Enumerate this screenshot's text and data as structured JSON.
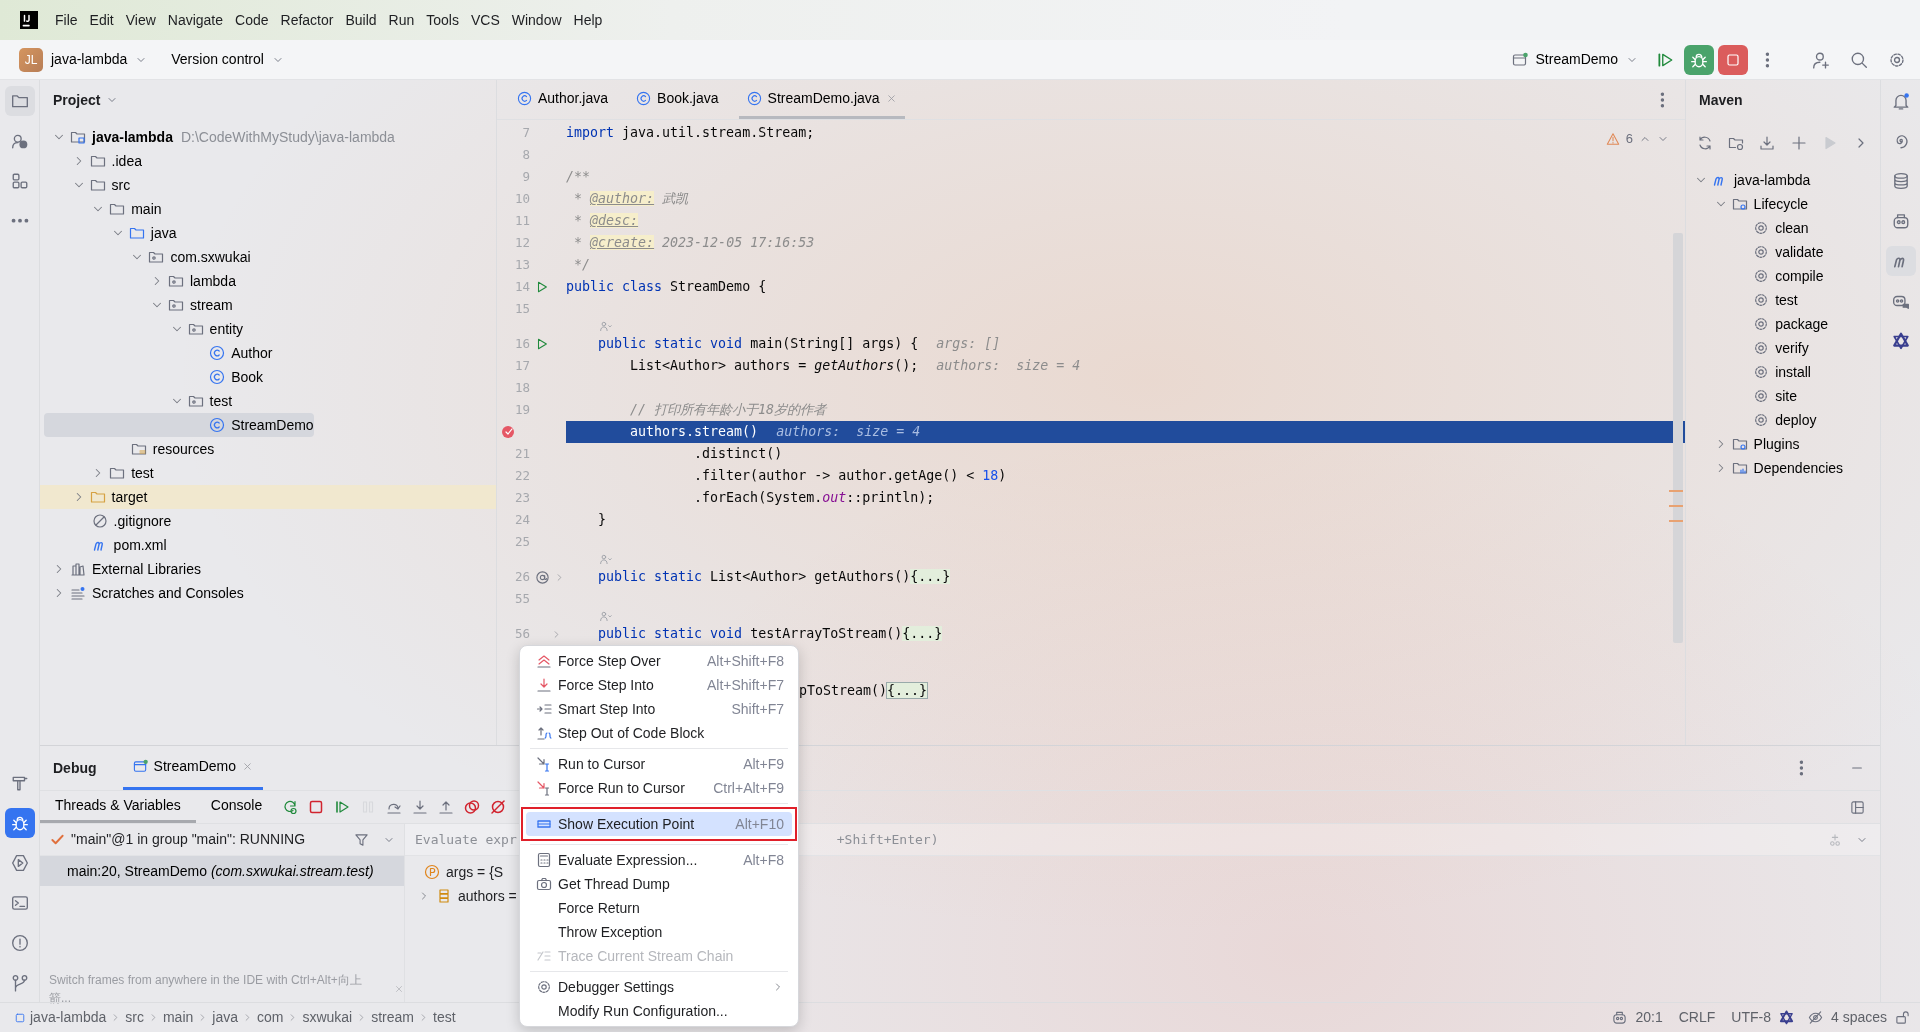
{
  "menu_bar": {
    "items": [
      "File",
      "Edit",
      "View",
      "Navigate",
      "Code",
      "Refactor",
      "Build",
      "Run",
      "Tools",
      "VCS",
      "Window",
      "Help"
    ]
  },
  "toolbar": {
    "project_initials": "JL",
    "project": "java-lambda",
    "vcs": "Version control",
    "run_config": "StreamDemo"
  },
  "project_panel": {
    "title": "Project",
    "tree": [
      {
        "label": "java-lambda",
        "path": "D:\\CodeWithMyStudy\\java-lambda",
        "kind": "module",
        "expanded": true,
        "selected": false,
        "children": [
          {
            "label": ".idea",
            "kind": "folder",
            "expanded": false,
            "selected": false
          },
          {
            "label": "src",
            "kind": "folder",
            "expanded": true,
            "selected": false,
            "children": [
              {
                "label": "main",
                "kind": "folder",
                "expanded": true,
                "selected": false,
                "children": [
                  {
                    "label": "java",
                    "kind": "source-folder",
                    "expanded": true,
                    "selected": false,
                    "children": [
                      {
                        "label": "com.sxwukai",
                        "kind": "package",
                        "expanded": true,
                        "selected": false,
                        "children": [
                          {
                            "label": "lambda",
                            "kind": "package",
                            "expanded": false,
                            "selected": false
                          },
                          {
                            "label": "stream",
                            "kind": "package",
                            "expanded": true,
                            "selected": false,
                            "children": [
                              {
                                "label": "entity",
                                "kind": "package",
                                "expanded": true,
                                "selected": false,
                                "children": [
                                  {
                                    "label": "Author",
                                    "kind": "class",
                                    "selected": false
                                  },
                                  {
                                    "label": "Book",
                                    "kind": "class",
                                    "selected": false
                                  }
                                ]
                              },
                              {
                                "label": "test",
                                "kind": "package",
                                "expanded": true,
                                "selected": false,
                                "children": [
                                  {
                                    "label": "StreamDemo",
                                    "kind": "class",
                                    "selected": true
                                  }
                                ]
                              }
                            ]
                          }
                        ]
                      }
                    ]
                  },
                  {
                    "label": "resources",
                    "kind": "resources-folder",
                    "selected": false
                  }
                ]
              },
              {
                "label": "test",
                "kind": "folder",
                "expanded": false,
                "selected": false
              }
            ]
          },
          {
            "label": "target",
            "kind": "excluded-folder",
            "expanded": false,
            "selected": false
          },
          {
            "label": ".gitignore",
            "kind": "ignore-file",
            "selected": false
          },
          {
            "label": "pom.xml",
            "kind": "maven-file",
            "selected": false
          }
        ]
      },
      {
        "label": "External Libraries",
        "kind": "libraries",
        "expanded": false,
        "selected": false
      },
      {
        "label": "Scratches and Consoles",
        "kind": "scratches",
        "expanded": false,
        "selected": false
      }
    ]
  },
  "editor": {
    "tabs": [
      {
        "label": "Author.java",
        "selected": false
      },
      {
        "label": "Book.java",
        "selected": false
      },
      {
        "label": "StreamDemo.java",
        "selected": true
      }
    ],
    "problems": "6",
    "lines": [
      {
        "kind": "code",
        "number": "7",
        "current": false,
        "tokens": [
          {
            "kind": "keyword",
            "text": "import "
          },
          {
            "kind": "plain",
            "text": "java.util.stream.Stream;"
          }
        ]
      },
      {
        "kind": "code",
        "number": "8",
        "current": false
      },
      {
        "kind": "code",
        "number": "9",
        "current": false,
        "tokens": [
          {
            "kind": "comment",
            "text": "/**"
          }
        ]
      },
      {
        "kind": "code",
        "number": "10",
        "current": false,
        "tokens": [
          {
            "kind": "comment",
            "text": " * "
          },
          {
            "kind": "doc-tag",
            "text": "@author:"
          },
          {
            "kind": "comment",
            "text": " 武凯"
          }
        ]
      },
      {
        "kind": "code",
        "number": "11",
        "current": false,
        "tokens": [
          {
            "kind": "comment",
            "text": " * "
          },
          {
            "kind": "doc-tag",
            "text": "@desc:"
          }
        ]
      },
      {
        "kind": "code",
        "number": "12",
        "current": false,
        "tokens": [
          {
            "kind": "comment",
            "text": " * "
          },
          {
            "kind": "doc-tag",
            "text": "@create:"
          },
          {
            "kind": "comment",
            "text": " 2023-12-05 17:16:53"
          }
        ]
      },
      {
        "kind": "code",
        "number": "13",
        "current": false,
        "tokens": [
          {
            "kind": "comment",
            "text": " */"
          }
        ]
      },
      {
        "kind": "code",
        "number": "14",
        "gutter": {
          "kind": "run"
        },
        "current": false,
        "tokens": [
          {
            "kind": "keyword",
            "text": "public class "
          },
          {
            "kind": "plain",
            "text": "StreamDemo {"
          }
        ]
      },
      {
        "kind": "code",
        "number": "15",
        "current": false
      },
      {
        "kind": "vision"
      },
      {
        "kind": "code",
        "number": "16",
        "gutter": {
          "kind": "run"
        },
        "current": false,
        "tokens": [
          {
            "kind": "keyword",
            "text": "    public static void "
          },
          {
            "kind": "plain",
            "text": "main(String[] args) {"
          }
        ],
        "hint": "args: []"
      },
      {
        "kind": "code",
        "number": "17",
        "current": false,
        "tokens": [
          {
            "kind": "plain",
            "text": "        List<Author> authors = "
          },
          {
            "kind": "italic",
            "text": "getAuthors"
          },
          {
            "kind": "plain",
            "text": "();"
          }
        ],
        "hint": "authors:  size = 4"
      },
      {
        "kind": "code",
        "number": "18",
        "current": false
      },
      {
        "kind": "code",
        "number": "19",
        "current": false,
        "tokens": [
          {
            "kind": "comment",
            "text": "        // 打印所有年龄小于18岁的作者"
          }
        ]
      },
      {
        "kind": "code",
        "gutter": {
          "kind": "breakpoint"
        },
        "current": true,
        "tokens": [
          {
            "kind": "plain",
            "text": "        authors.stream()"
          }
        ],
        "hint": "authors:  size = 4"
      },
      {
        "kind": "code",
        "number": "21",
        "current": false,
        "tokens": [
          {
            "kind": "plain",
            "text": "                .distinct()"
          }
        ]
      },
      {
        "kind": "code",
        "number": "22",
        "current": false,
        "tokens": [
          {
            "kind": "plain",
            "text": "                .filter(author -> author.getAge() < "
          },
          {
            "kind": "number",
            "text": "18"
          },
          {
            "kind": "plain",
            "text": ")"
          }
        ]
      },
      {
        "kind": "code",
        "number": "23",
        "current": false,
        "tokens": [
          {
            "kind": "plain",
            "text": "                .forEach(System."
          },
          {
            "kind": "field",
            "text": "out"
          },
          {
            "kind": "plain",
            "text": "::println);"
          }
        ]
      },
      {
        "kind": "code",
        "number": "24",
        "current": false,
        "tokens": [
          {
            "kind": "plain",
            "text": "    }"
          }
        ]
      },
      {
        "kind": "code",
        "number": "25",
        "current": false
      },
      {
        "kind": "vision"
      },
      {
        "kind": "code",
        "number": "26",
        "gutter": {
          "kind": "implements"
        },
        "folded": true,
        "current": false,
        "tokens": [
          {
            "kind": "keyword",
            "text": "    public static "
          },
          {
            "kind": "plain",
            "text": "List<Author> getAuthors()"
          },
          {
            "kind": "folded",
            "text": "{...}"
          }
        ]
      },
      {
        "kind": "code",
        "number": "55",
        "current": false
      },
      {
        "kind": "vision"
      },
      {
        "kind": "code",
        "number": "56",
        "folded": true,
        "current": false,
        "tokens": [
          {
            "kind": "keyword",
            "text": "    public static void "
          },
          {
            "kind": "plain",
            "text": "testArrayToStream()"
          },
          {
            "kind": "folded",
            "text": "{...}"
          }
        ]
      },
      {
        "kind": "partial",
        "current": false,
        "tokens": [
          {
            "kind": "plain",
            "text": "pToStream()"
          },
          {
            "kind": "folded-selected",
            "text": "{...}"
          }
        ]
      }
    ]
  },
  "maven": {
    "title": "Maven",
    "tree": [
      {
        "label": "java-lambda",
        "kind": "maven-project",
        "expanded": true,
        "selected": false,
        "children": [
          {
            "label": "Lifecycle",
            "kind": "config-folder",
            "expanded": true,
            "selected": false,
            "children": [
              {
                "label": "clean",
                "kind": "goal",
                "selected": false
              },
              {
                "label": "validate",
                "kind": "goal",
                "selected": false
              },
              {
                "label": "compile",
                "kind": "goal",
                "selected": false
              },
              {
                "label": "test",
                "kind": "goal",
                "selected": false
              },
              {
                "label": "package",
                "kind": "goal",
                "selected": false
              },
              {
                "label": "verify",
                "kind": "goal",
                "selected": false
              },
              {
                "label": "install",
                "kind": "goal",
                "selected": false
              },
              {
                "label": "site",
                "kind": "goal",
                "selected": false
              },
              {
                "label": "deploy",
                "kind": "goal",
                "selected": false
              }
            ]
          },
          {
            "label": "Plugins",
            "kind": "config-folder",
            "expanded": false,
            "selected": false
          },
          {
            "label": "Dependencies",
            "kind": "deps-folder",
            "expanded": false,
            "selected": false
          }
        ]
      }
    ]
  },
  "debug": {
    "title": "Debug",
    "session_tabs": [
      {
        "label": "StreamDemo",
        "selected": true
      }
    ],
    "view_tabs": [
      {
        "label": "Threads & Variables",
        "selected": true
      },
      {
        "label": "Console",
        "selected": false
      }
    ],
    "toolbar": [
      {
        "kind": "rerun",
        "disabled": false
      },
      {
        "kind": "stop",
        "disabled": false
      },
      {
        "kind": "resume",
        "disabled": false
      },
      {
        "kind": "pause",
        "disabled": true
      },
      {
        "kind": "step-over",
        "disabled": false
      },
      {
        "kind": "step-into",
        "disabled": false
      },
      {
        "kind": "step-out",
        "disabled": false
      },
      {
        "kind": "breakpoints",
        "disabled": false
      },
      {
        "kind": "mute",
        "disabled": false
      }
    ],
    "thread": "\"main\"@1 in group \"main\": RUNNING",
    "frames": [
      {
        "text": "main:20, StreamDemo *(com.sxwukai.stream.test)*",
        "selected": true
      }
    ],
    "evaluate_placeholder": [
      "Evaluate expr",
      "+Shift+Enter)"
    ],
    "variables": [
      {
        "kind": "parameter",
        "text": "args = {S",
        "expandable": false
      },
      {
        "kind": "local",
        "text": "authors =",
        "expandable": true
      }
    ],
    "tip": "Switch frames from anywhere in the IDE with Ctrl+Alt+向上箭..."
  },
  "context_menu": {
    "items": [
      {
        "kind": "force-step-over",
        "label": "Force Step Over",
        "shortcut": "Alt+Shift+F8",
        "selected": false,
        "disabled": false,
        "outlined": false
      },
      {
        "kind": "force-step-into",
        "label": "Force Step Into",
        "shortcut": "Alt+Shift+F7",
        "selected": false,
        "disabled": false,
        "outlined": false
      },
      {
        "kind": "smart-step",
        "label": "Smart Step Into",
        "shortcut": "Shift+F7",
        "selected": false,
        "disabled": false,
        "outlined": false
      },
      {
        "kind": "step-out-block",
        "label": "Step Out of Code Block",
        "selected": false,
        "disabled": false,
        "outlined": false
      },
      {
        "kind": "separator"
      },
      {
        "kind": "run-cursor",
        "label": "Run to Cursor",
        "shortcut": "Alt+F9",
        "selected": false,
        "disabled": false,
        "outlined": false
      },
      {
        "kind": "force-run-cursor",
        "label": "Force Run to Cursor",
        "shortcut": "Ctrl+Alt+F9",
        "selected": false,
        "disabled": false,
        "outlined": false
      },
      {
        "kind": "separator"
      },
      {
        "kind": "exec-point",
        "label": "Show Execution Point",
        "shortcut": "Alt+F10",
        "selected": true,
        "disabled": false,
        "outlined": true
      },
      {
        "kind": "separator"
      },
      {
        "kind": "calculator",
        "label": "Evaluate Expression...",
        "shortcut": "Alt+F8",
        "selected": false,
        "disabled": false,
        "outlined": false
      },
      {
        "kind": "camera",
        "label": "Get Thread Dump",
        "selected": false,
        "disabled": false,
        "outlined": false
      },
      {
        "kind": "plain",
        "label": "Force Return",
        "selected": false,
        "disabled": false,
        "outlined": false
      },
      {
        "kind": "plain",
        "label": "Throw Exception",
        "selected": false,
        "disabled": false,
        "outlined": false
      },
      {
        "kind": "trace",
        "label": "Trace Current Stream Chain",
        "selected": false,
        "disabled": true,
        "outlined": false
      },
      {
        "kind": "separator"
      },
      {
        "kind": "gear",
        "label": "Debugger Settings",
        "submenu": true,
        "selected": false,
        "disabled": false,
        "outlined": false
      },
      {
        "kind": "plain",
        "label": "Modify Run Configuration...",
        "selected": false,
        "disabled": false,
        "outlined": false
      }
    ]
  },
  "status_bar": {
    "breadcrumbs": [
      "java-lambda",
      "src",
      "main",
      "java",
      "com",
      "sxwukai",
      "stream",
      "test"
    ],
    "items": [
      "20:1",
      "CRLF",
      "UTF-8",
      "4 spaces"
    ]
  }
}
